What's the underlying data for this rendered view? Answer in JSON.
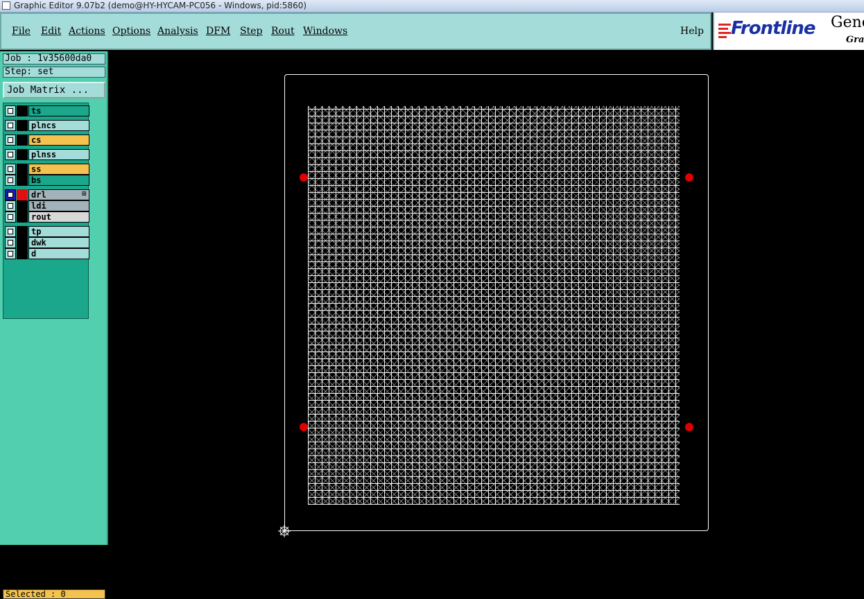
{
  "window": {
    "title": "Graphic Editor 9.07b2 (demo@HY-HYCAM-PC056 - Windows, pid:5860)"
  },
  "menu": {
    "items": [
      "File",
      "Edit",
      "Actions",
      "Options",
      "Analysis",
      "DFM",
      "Step",
      "Rout",
      "Windows"
    ],
    "help": "Help"
  },
  "brand": {
    "logo": "Frontline",
    "product": "Gene",
    "subtitle": "Grap"
  },
  "panel": {
    "job": "Job : 1v35600da0",
    "step": "Step: set",
    "job_matrix": "Job Matrix ...",
    "selected": "Selected : 0"
  },
  "layers": [
    {
      "name": "ts",
      "bg": "#1aa78c"
    },
    {
      "name": "plncs",
      "bg": "#a4dcd9"
    },
    {
      "name": "cs",
      "bg": "#f4c34f"
    },
    {
      "name": "plnss",
      "bg": "#a4dcd9"
    },
    {
      "name": "ss",
      "bg": "#f4c34f"
    },
    {
      "name": "bs",
      "bg": "#1aa78c"
    },
    {
      "name": "drl",
      "bg": "#a3b3bb",
      "active": true,
      "color": "red"
    },
    {
      "name": "ldi",
      "bg": "#a3b3bb"
    },
    {
      "name": "rout",
      "bg": "#d8d8d8"
    },
    {
      "name": "tp",
      "bg": "#a4dcd9"
    },
    {
      "name": "dwk",
      "bg": "#a4dcd9"
    },
    {
      "name": "d",
      "bg": "#a4dcd9"
    }
  ],
  "colors": {
    "menubar": "#a4dcd9",
    "panel": "#52cfae",
    "fiducial": "#e00000"
  }
}
